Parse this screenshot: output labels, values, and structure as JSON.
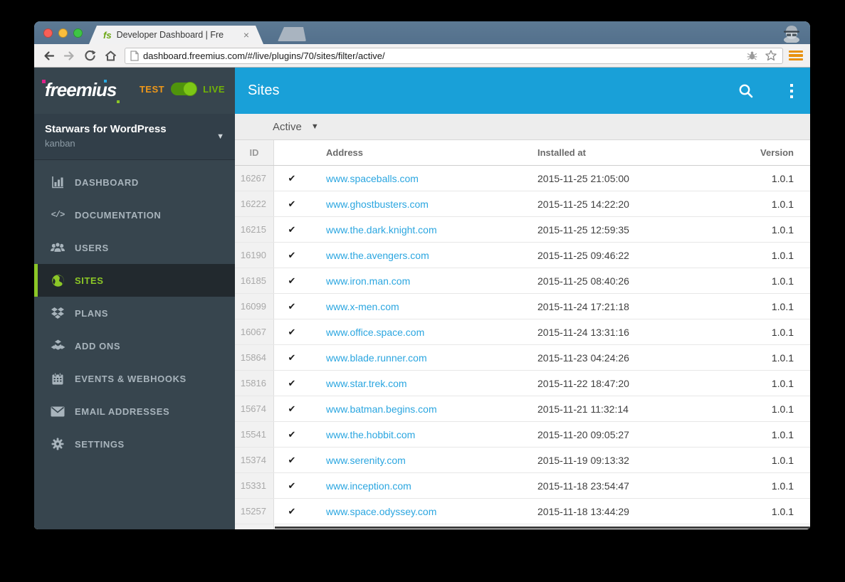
{
  "colors": {
    "accent_green": "#8cc727",
    "live_green": "#72b307",
    "test_orange": "#f09819",
    "appbar_blue": "#19a0d8",
    "sidebar_dark": "#37454e",
    "link_blue": "#2ba6e0",
    "traffic_red": "#f95f57",
    "traffic_yellow": "#fbbe3c",
    "traffic_green": "#3ec544"
  },
  "browser": {
    "tab_title": "Developer Dashboard | Fre",
    "tab_close_glyph": "×",
    "favicon_text": "fs",
    "url": "dashboard.freemius.com/#/live/plugins/70/sites/filter/active/"
  },
  "sidebar": {
    "logo_text": "freemius",
    "env_toggle": {
      "test_label": "TEST",
      "live_label": "LIVE",
      "state": "LIVE"
    },
    "plugin": {
      "name": "Starwars for WordPress",
      "subtitle": "kanban"
    },
    "items": [
      {
        "label": "DASHBOARD",
        "icon": "bar-chart",
        "active": false
      },
      {
        "label": "DOCUMENTATION",
        "icon": "code",
        "active": false
      },
      {
        "label": "USERS",
        "icon": "users",
        "active": false
      },
      {
        "label": "SITES",
        "icon": "globe",
        "active": true
      },
      {
        "label": "PLANS",
        "icon": "plans",
        "active": false
      },
      {
        "label": "ADD ONS",
        "icon": "cubes",
        "active": false
      },
      {
        "label": "EVENTS & WEBHOOKS",
        "icon": "calendar",
        "active": false
      },
      {
        "label": "EMAIL ADDRESSES",
        "icon": "envelope",
        "active": false
      },
      {
        "label": "SETTINGS",
        "icon": "gear",
        "active": false
      }
    ]
  },
  "header": {
    "title": "Sites"
  },
  "filter": {
    "selected": "Active"
  },
  "glyphs": {
    "caret_down": "▼",
    "code_icon": "</>"
  },
  "table": {
    "columns": [
      "ID",
      "Address",
      "Installed at",
      "Version"
    ],
    "check_glyph": "✔",
    "rows": [
      {
        "id": "16267",
        "address": "www.spaceballs.com",
        "installed_at": "2015-11-25 21:05:00",
        "version": "1.0.1"
      },
      {
        "id": "16222",
        "address": "www.ghostbusters.com",
        "installed_at": "2015-11-25 14:22:20",
        "version": "1.0.1"
      },
      {
        "id": "16215",
        "address": "www.the.dark.knight.com",
        "installed_at": "2015-11-25 12:59:35",
        "version": "1.0.1"
      },
      {
        "id": "16190",
        "address": "www.the.avengers.com",
        "installed_at": "2015-11-25 09:46:22",
        "version": "1.0.1"
      },
      {
        "id": "16185",
        "address": "www.iron.man.com",
        "installed_at": "2015-11-25 08:40:26",
        "version": "1.0.1"
      },
      {
        "id": "16099",
        "address": "www.x-men.com",
        "installed_at": "2015-11-24 17:21:18",
        "version": "1.0.1"
      },
      {
        "id": "16067",
        "address": "www.office.space.com",
        "installed_at": "2015-11-24 13:31:16",
        "version": "1.0.1"
      },
      {
        "id": "15864",
        "address": "www.blade.runner.com",
        "installed_at": "2015-11-23 04:24:26",
        "version": "1.0.1"
      },
      {
        "id": "15816",
        "address": "www.star.trek.com",
        "installed_at": "2015-11-22 18:47:20",
        "version": "1.0.1"
      },
      {
        "id": "15674",
        "address": "www.batman.begins.com",
        "installed_at": "2015-11-21 11:32:14",
        "version": "1.0.1"
      },
      {
        "id": "15541",
        "address": "www.the.hobbit.com",
        "installed_at": "2015-11-20 09:05:27",
        "version": "1.0.1"
      },
      {
        "id": "15374",
        "address": "www.serenity.com",
        "installed_at": "2015-11-19 09:13:32",
        "version": "1.0.1"
      },
      {
        "id": "15331",
        "address": "www.inception.com",
        "installed_at": "2015-11-18 23:54:47",
        "version": "1.0.1"
      },
      {
        "id": "15257",
        "address": "www.space.odyssey.com",
        "installed_at": "2015-11-18 13:44:29",
        "version": "1.0.1"
      }
    ]
  }
}
